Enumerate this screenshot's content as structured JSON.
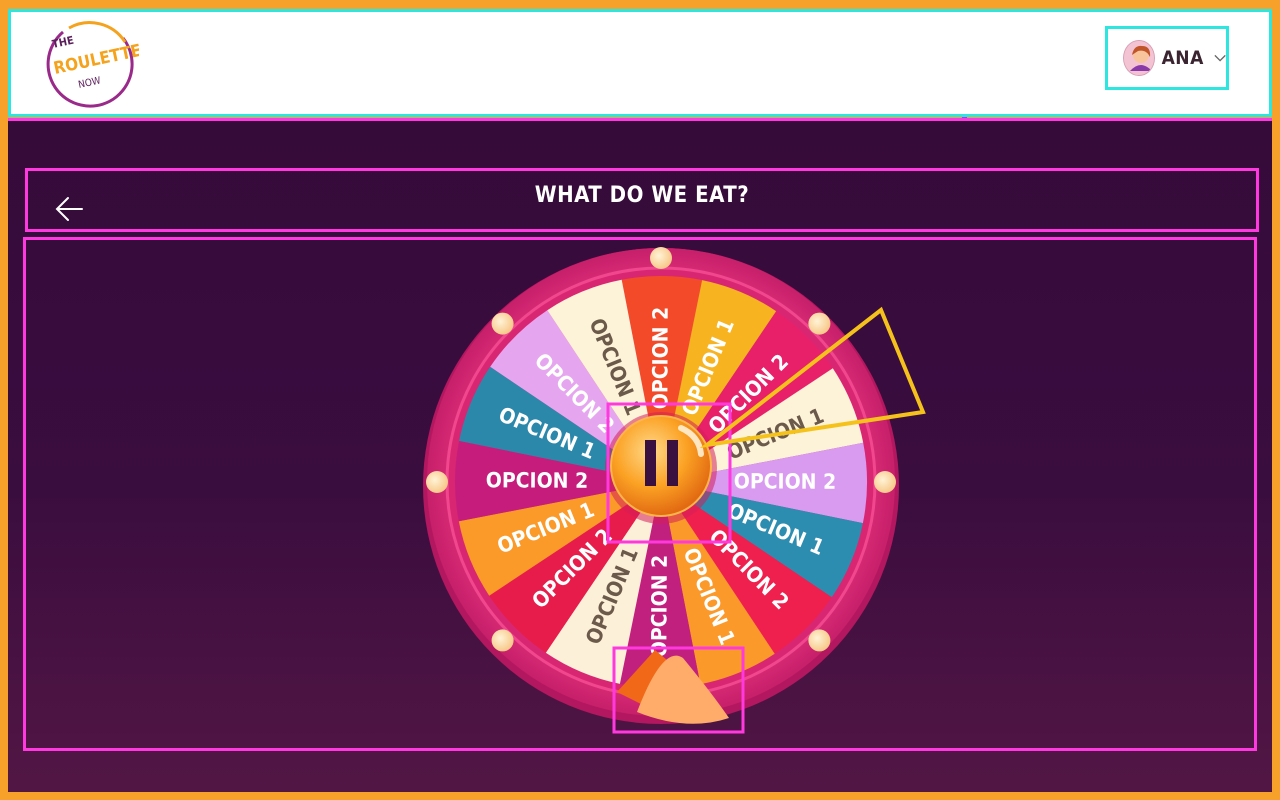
{
  "header": {
    "logo": {
      "line1": "THE",
      "line2": "ROULETTE",
      "line3": "NOW"
    },
    "user": {
      "name": "ANA"
    }
  },
  "main": {
    "title": "WHAT DO WE EAT?"
  },
  "wheel": {
    "segments": [
      {
        "label": "OPCION 2",
        "color": "#f34b2a",
        "text": "#ffffff"
      },
      {
        "label": "OPCION 1",
        "color": "#f7b320",
        "text": "#ffffff"
      },
      {
        "label": "OPCION 2",
        "color": "#e8206a",
        "text": "#ffffff"
      },
      {
        "label": "OPCION 1",
        "color": "#fdf3d8",
        "text": "#6b5a4a"
      },
      {
        "label": "OPCION 2",
        "color": "#d89bf0",
        "text": "#ffffff"
      },
      {
        "label": "OPCION 1",
        "color": "#2d8db0",
        "text": "#ffffff"
      },
      {
        "label": "OPCION 2",
        "color": "#f0204e",
        "text": "#ffffff"
      },
      {
        "label": "OPCION 1",
        "color": "#fb9a2a",
        "text": "#ffffff"
      },
      {
        "label": "OPCION 2",
        "color": "#c2207e",
        "text": "#ffffff"
      },
      {
        "label": "OPCION 1",
        "color": "#fdf0d8",
        "text": "#6b5a4a"
      },
      {
        "label": "OPCION 2",
        "color": "#e81c4a",
        "text": "#ffffff"
      },
      {
        "label": "OPCION 1",
        "color": "#fb9a28",
        "text": "#ffffff"
      },
      {
        "label": "OPCION 2",
        "color": "#c61d7c",
        "text": "#ffffff"
      },
      {
        "label": "OPCION 1",
        "color": "#2b88ab",
        "text": "#ffffff"
      },
      {
        "label": "OPCION 2",
        "color": "#e6a6ef",
        "text": "#ffffff"
      },
      {
        "label": "OPCION 1",
        "color": "#fdf3d8",
        "text": "#6b5a4a"
      }
    ],
    "center_button_icon": "pause-icon",
    "pointer_icon": "pointer-icon"
  },
  "colors": {
    "accent": "#ff38e0",
    "header_outline": "#2ee6e0",
    "background": "#350b3a",
    "frame": "#f7a12a"
  }
}
